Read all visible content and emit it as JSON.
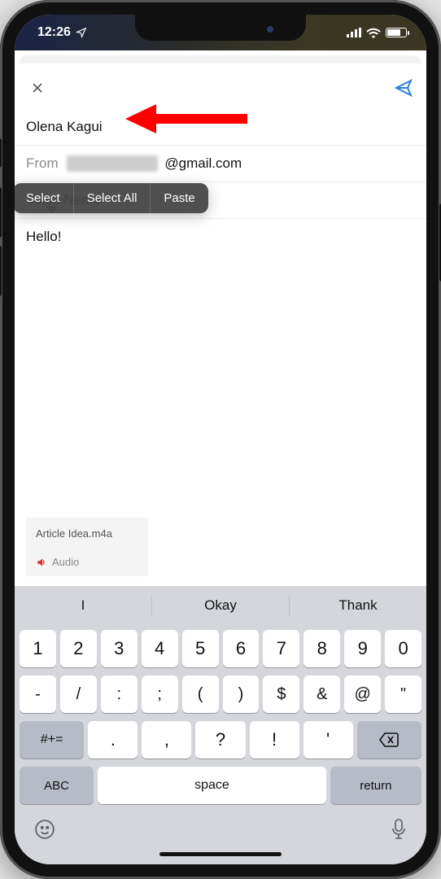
{
  "status": {
    "time": "12:26",
    "location_icon": "location-arrow-icon",
    "signal_icon": "signal-icon",
    "wifi_icon": "wifi-icon",
    "battery_icon": "battery-icon"
  },
  "compose": {
    "close_icon": "close-icon",
    "send_icon": "send-icon",
    "to_value": "Olena Kagui",
    "from_label": "From",
    "from_masked": "█████████",
    "from_domain": "@gmail.com",
    "subject_value": "Voice Nemo",
    "body_text": "Hello!"
  },
  "context_menu": {
    "select": "Select",
    "select_all": "Select All",
    "paste": "Paste"
  },
  "attachment": {
    "filename": "Article Idea.m4a",
    "kind_label": "Audio",
    "icon": "audio-icon"
  },
  "suggestions": {
    "s1": "I",
    "s2": "Okay",
    "s3": "Thank"
  },
  "keyboard": {
    "row1": [
      "1",
      "2",
      "3",
      "4",
      "5",
      "6",
      "7",
      "8",
      "9",
      "0"
    ],
    "row2": [
      "-",
      "/",
      ":",
      ";",
      "(",
      ")",
      "$",
      "&",
      "@",
      "\""
    ],
    "shift": "#+=",
    "row3": [
      ".",
      ",",
      "?",
      "!",
      "'"
    ],
    "backspace_icon": "backspace-icon",
    "abc": "ABC",
    "space": "space",
    "return": "return",
    "emoji_icon": "emoji-icon",
    "mic_icon": "mic-icon"
  }
}
